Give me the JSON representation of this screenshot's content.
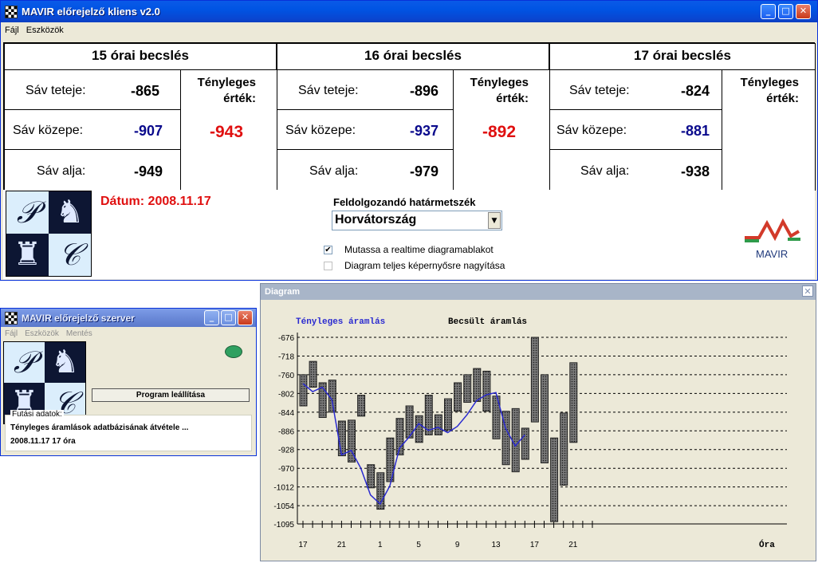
{
  "client": {
    "title": "MAVIR előrejelző kliens v2.0",
    "menu": [
      "Fájl",
      "Eszközök"
    ],
    "forecasts": [
      {
        "header": "15 órai becslés",
        "top_label": "Sáv teteje:",
        "top": "-865",
        "mid_label": "Sáv közepe:",
        "mid": "-907",
        "bottom_label": "Sáv alja:",
        "bottom": "-949",
        "actual_label_1": "Tényleges",
        "actual_label_2": "érték:",
        "actual": "-943"
      },
      {
        "header": "16 órai becslés",
        "top_label": "Sáv teteje:",
        "top": "-896",
        "mid_label": "Sáv közepe:",
        "mid": "-937",
        "bottom_label": "Sáv alja:",
        "bottom": "-979",
        "actual_label_1": "Tényleges",
        "actual_label_2": "érték:",
        "actual": "-892"
      },
      {
        "header": "17 órai becslés",
        "top_label": "Sáv teteje:",
        "top": "-824",
        "mid_label": "Sáv közepe:",
        "mid": "-881",
        "bottom_label": "Sáv alja:",
        "bottom": "-938",
        "actual_label_1": "Tényleges",
        "actual_label_2": "érték:",
        "actual": ""
      }
    ],
    "date_text": "Dátum: 2008.11.17",
    "border_label": "Feldolgozandó határmetszék",
    "border_selected": "Horvátország",
    "checkbox_realtime": {
      "label": "Mutassa a realtime diagramablakot",
      "checked": true
    },
    "checkbox_fullscreen": {
      "label": "Diagram teljes képernyősre nagyítása",
      "checked": false
    },
    "brand_logo_text": "MAVIR",
    "logo_letters": [
      "𝒫",
      "♞",
      "♜",
      "𝒞"
    ]
  },
  "server": {
    "title": "MAVIR előrejelző szerver",
    "menu": [
      "Fájl",
      "Eszközök",
      "Mentés"
    ],
    "stop_button": "Program leállítása",
    "run_group_label": "Futási adatok:",
    "run_line_1": "Tényleges áramlások adatbázisának átvétele ...",
    "run_line_2": "2008.11.17 17 óra",
    "status_color": "#2fa060"
  },
  "diagram": {
    "title": "Diagram",
    "chart_data": {
      "type": "line",
      "legend": [
        "Tényleges áramlás",
        "Becsült áramlás"
      ],
      "yticks": [
        "-676",
        "-718",
        "-760",
        "-802",
        "-844",
        "-886",
        "-928",
        "-970",
        "-1012",
        "-1054",
        "-1095"
      ],
      "ylim": [
        -1095,
        -676
      ],
      "xticks": [
        "17",
        "21",
        "1",
        "5",
        "9",
        "13",
        "17",
        "21"
      ],
      "xlabel": "Óra",
      "hours": [
        17,
        18,
        19,
        20,
        21,
        22,
        23,
        0,
        1,
        2,
        3,
        4,
        5,
        6,
        7,
        8,
        9,
        10,
        11,
        12,
        13,
        14,
        15,
        16,
        17,
        18,
        19,
        20,
        21,
        22,
        23
      ],
      "band_top": [
        -760,
        -730,
        -778,
        -772,
        -864,
        -862,
        -806,
        -962,
        -980,
        -902,
        -858,
        -830,
        -852,
        -806,
        -850,
        -814,
        -778,
        -760,
        -746,
        -752,
        -808,
        -842,
        -836,
        -880,
        -676,
        -760,
        -902,
        -846,
        -733,
        null,
        null
      ],
      "band_bottom": [
        -830,
        -788,
        -856,
        -844,
        -942,
        -956,
        -853,
        -1014,
        -1062,
        -1000,
        -940,
        -902,
        -912,
        -895,
        -895,
        -884,
        -842,
        -822,
        -820,
        -842,
        -904,
        -962,
        -978,
        -950,
        -866,
        -958,
        -1090,
        -1008,
        -912,
        null,
        null
      ],
      "actual": [
        -780,
        -798,
        -788,
        -816,
        -940,
        -930,
        -970,
        -1030,
        -1050,
        -1010,
        -925,
        -900,
        -870,
        -885,
        -878,
        -890,
        -876,
        -850,
        -818,
        -805,
        -800,
        -880,
        -920,
        -895,
        null,
        null,
        null,
        null,
        null,
        null,
        null
      ]
    }
  }
}
